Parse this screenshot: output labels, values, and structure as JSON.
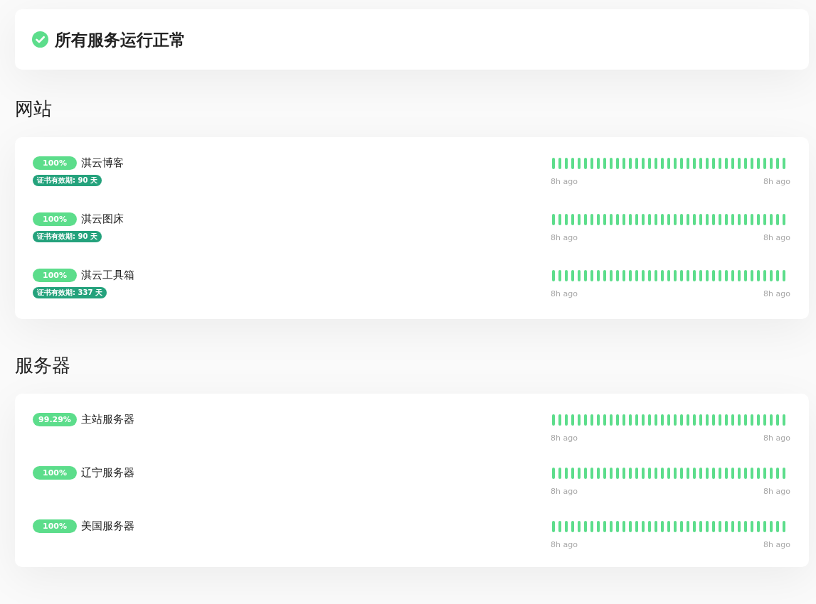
{
  "banner": {
    "all_operational": true,
    "title": "所有服务运行正常"
  },
  "groups": [
    {
      "title": "网站",
      "monitors": [
        {
          "uptime": "100%",
          "name": "淇云博客",
          "certificate": "证书有效期: 90 天",
          "time_start": "8h ago",
          "time_end": "8h ago",
          "beats": [
            {
              "up": true
            },
            {
              "up": true
            },
            {
              "up": true
            },
            {
              "up": true
            },
            {
              "up": true
            },
            {
              "up": true
            },
            {
              "up": true
            },
            {
              "up": true
            },
            {
              "up": true
            },
            {
              "up": true
            },
            {
              "up": true
            },
            {
              "up": true
            },
            {
              "up": true
            },
            {
              "up": true
            },
            {
              "up": true
            },
            {
              "up": true
            },
            {
              "up": true
            },
            {
              "up": true
            },
            {
              "up": true
            },
            {
              "up": true
            },
            {
              "up": true
            },
            {
              "up": true
            },
            {
              "up": true
            },
            {
              "up": true
            },
            {
              "up": true
            },
            {
              "up": true
            },
            {
              "up": true
            },
            {
              "up": true
            },
            {
              "up": true
            },
            {
              "up": true
            },
            {
              "up": true
            },
            {
              "up": true
            },
            {
              "up": true
            },
            {
              "up": true
            },
            {
              "up": true
            },
            {
              "up": true
            },
            {
              "up": true
            }
          ]
        },
        {
          "uptime": "100%",
          "name": "淇云图床",
          "certificate": "证书有效期: 90 天",
          "time_start": "8h ago",
          "time_end": "8h ago",
          "beats": [
            {
              "up": true
            },
            {
              "up": true
            },
            {
              "up": true
            },
            {
              "up": true
            },
            {
              "up": true
            },
            {
              "up": true
            },
            {
              "up": true
            },
            {
              "up": true
            },
            {
              "up": true
            },
            {
              "up": true
            },
            {
              "up": true
            },
            {
              "up": true
            },
            {
              "up": true
            },
            {
              "up": true
            },
            {
              "up": true
            },
            {
              "up": true
            },
            {
              "up": true
            },
            {
              "up": true
            },
            {
              "up": true
            },
            {
              "up": true
            },
            {
              "up": true
            },
            {
              "up": true
            },
            {
              "up": true
            },
            {
              "up": true
            },
            {
              "up": true
            },
            {
              "up": true
            },
            {
              "up": true
            },
            {
              "up": true
            },
            {
              "up": true
            },
            {
              "up": true
            },
            {
              "up": true
            },
            {
              "up": true
            },
            {
              "up": true
            },
            {
              "up": true
            },
            {
              "up": true
            },
            {
              "up": true
            },
            {
              "up": true
            }
          ]
        },
        {
          "uptime": "100%",
          "name": "淇云工具箱",
          "certificate": "证书有效期: 337 天",
          "time_start": "8h ago",
          "time_end": "8h ago",
          "beats": [
            {
              "up": true
            },
            {
              "up": true
            },
            {
              "up": true
            },
            {
              "up": true
            },
            {
              "up": true
            },
            {
              "up": true
            },
            {
              "up": true
            },
            {
              "up": true
            },
            {
              "up": true
            },
            {
              "up": true
            },
            {
              "up": true
            },
            {
              "up": true
            },
            {
              "up": true
            },
            {
              "up": true
            },
            {
              "up": true
            },
            {
              "up": true
            },
            {
              "up": true
            },
            {
              "up": true
            },
            {
              "up": true
            },
            {
              "up": true
            },
            {
              "up": true
            },
            {
              "up": true
            },
            {
              "up": true
            },
            {
              "up": true
            },
            {
              "up": true
            },
            {
              "up": true
            },
            {
              "up": true
            },
            {
              "up": true
            },
            {
              "up": true
            },
            {
              "up": true
            },
            {
              "up": true
            },
            {
              "up": true
            },
            {
              "up": true
            },
            {
              "up": true
            },
            {
              "up": true
            },
            {
              "up": true
            },
            {
              "up": true
            }
          ]
        }
      ]
    },
    {
      "title": "服务器",
      "monitors": [
        {
          "uptime": "99.29%",
          "name": "主站服务器",
          "time_start": "8h ago",
          "time_end": "8h ago",
          "beats": [
            {
              "up": true
            },
            {
              "up": true
            },
            {
              "up": true
            },
            {
              "up": true
            },
            {
              "up": true
            },
            {
              "up": true
            },
            {
              "up": true
            },
            {
              "up": true
            },
            {
              "up": true
            },
            {
              "up": true
            },
            {
              "up": true
            },
            {
              "up": true
            },
            {
              "up": true
            },
            {
              "up": true
            },
            {
              "up": true
            },
            {
              "up": true
            },
            {
              "up": true
            },
            {
              "up": true
            },
            {
              "up": true
            },
            {
              "up": true
            },
            {
              "up": true
            },
            {
              "up": true
            },
            {
              "up": true
            },
            {
              "up": true
            },
            {
              "up": true
            },
            {
              "up": true
            },
            {
              "up": true
            },
            {
              "up": true
            },
            {
              "up": true
            },
            {
              "up": true
            },
            {
              "up": true
            },
            {
              "up": true
            },
            {
              "up": true
            },
            {
              "up": true
            },
            {
              "up": true
            },
            {
              "up": true
            },
            {
              "up": true
            }
          ]
        },
        {
          "uptime": "100%",
          "name": "辽宁服务器",
          "time_start": "8h ago",
          "time_end": "8h ago",
          "beats": [
            {
              "up": true
            },
            {
              "up": true
            },
            {
              "up": true
            },
            {
              "up": true
            },
            {
              "up": true
            },
            {
              "up": true
            },
            {
              "up": true
            },
            {
              "up": true
            },
            {
              "up": true
            },
            {
              "up": true
            },
            {
              "up": true
            },
            {
              "up": true
            },
            {
              "up": true
            },
            {
              "up": true
            },
            {
              "up": true
            },
            {
              "up": true
            },
            {
              "up": true
            },
            {
              "up": true
            },
            {
              "up": true
            },
            {
              "up": true
            },
            {
              "up": true
            },
            {
              "up": true
            },
            {
              "up": true
            },
            {
              "up": true
            },
            {
              "up": true
            },
            {
              "up": true
            },
            {
              "up": true
            },
            {
              "up": true
            },
            {
              "up": true
            },
            {
              "up": true
            },
            {
              "up": true
            },
            {
              "up": true
            },
            {
              "up": true
            },
            {
              "up": true
            },
            {
              "up": true
            },
            {
              "up": true
            },
            {
              "up": true
            }
          ]
        },
        {
          "uptime": "100%",
          "name": "美国服务器",
          "time_start": "8h ago",
          "time_end": "8h ago",
          "beats": [
            {
              "up": true
            },
            {
              "up": true
            },
            {
              "up": true
            },
            {
              "up": true
            },
            {
              "up": true
            },
            {
              "up": true
            },
            {
              "up": true
            },
            {
              "up": true
            },
            {
              "up": true
            },
            {
              "up": true
            },
            {
              "up": true
            },
            {
              "up": true
            },
            {
              "up": true
            },
            {
              "up": true
            },
            {
              "up": true
            },
            {
              "up": true
            },
            {
              "up": true
            },
            {
              "up": true
            },
            {
              "up": true
            },
            {
              "up": true
            },
            {
              "up": true
            },
            {
              "up": true
            },
            {
              "up": true
            },
            {
              "up": true
            },
            {
              "up": true
            },
            {
              "up": true
            },
            {
              "up": true
            },
            {
              "up": true
            },
            {
              "up": true
            },
            {
              "up": true
            },
            {
              "up": true
            },
            {
              "up": true
            },
            {
              "up": true
            },
            {
              "up": true
            },
            {
              "up": true
            },
            {
              "up": true
            },
            {
              "up": true
            }
          ]
        }
      ]
    }
  ]
}
